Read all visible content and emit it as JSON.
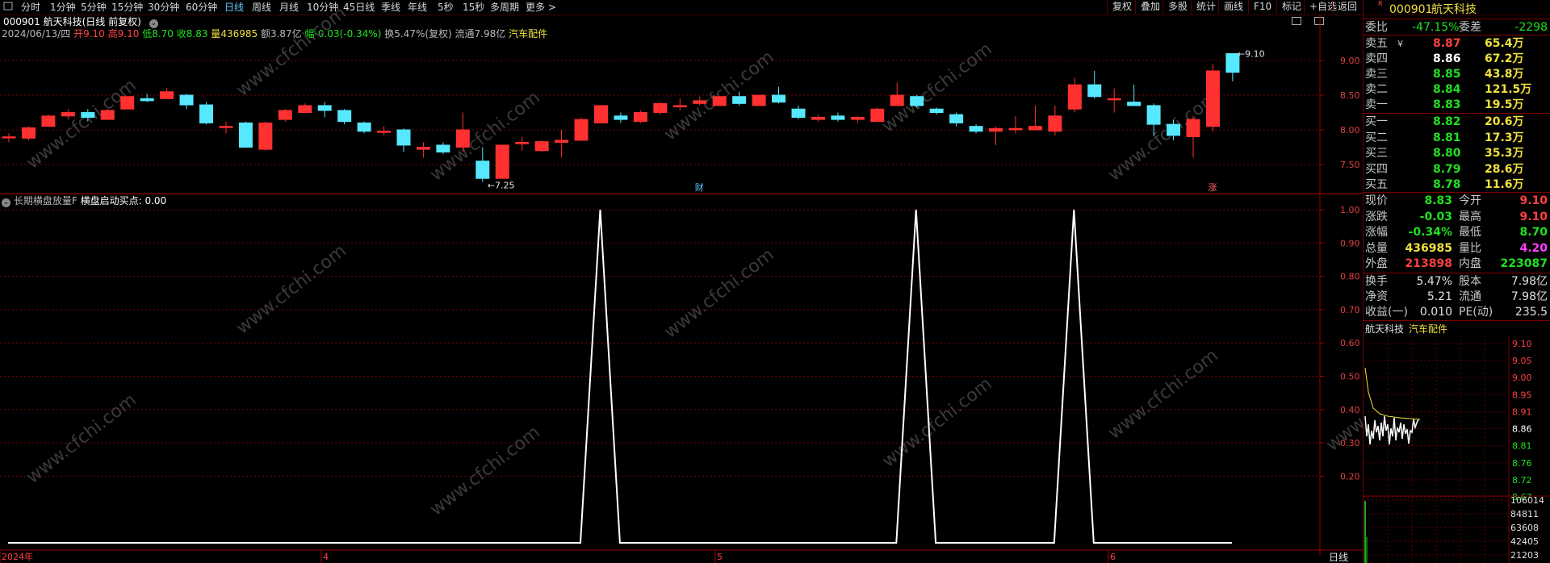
{
  "toolbar": {
    "periods": [
      "分时",
      "1分钟",
      "5分钟",
      "15分钟",
      "30分钟",
      "60分钟",
      "日线",
      "周线",
      "月线",
      "10分钟",
      "45日线",
      "季线",
      "年线",
      "5秒",
      "15秒",
      "多周期",
      "更多 >"
    ],
    "active_period": "日线",
    "right_buttons": [
      "复权",
      "叠加",
      "多股",
      "统计",
      "画线",
      "F10",
      "标记",
      "+自选",
      "返回"
    ]
  },
  "stock": {
    "code": "000901",
    "name": "航天科技",
    "title_line": "000901 航天科技(日线 前复权)",
    "date": "2024/06/13/四",
    "open_label": "开",
    "open": "9.10",
    "high_label": "高",
    "high": "9.10",
    "low_label": "低",
    "low": "8.70",
    "close_label": "收",
    "close": "8.83",
    "vol_label": "量",
    "vol": "436985",
    "amount": "额3.87亿",
    "chg": "幅-0.03(-0.34%)",
    "turnover": "换5.47%(复权)",
    "float_cap": "流通7.98亿",
    "sector": "汽车配件"
  },
  "indicator": {
    "title": "长期横盘放量F",
    "buy_label": "横盘启动买点:",
    "buy_value": "0.00"
  },
  "chart_data": [
    {
      "type": "candlestick",
      "title": "000901 航天科技(日线 前复权)",
      "y_ticks": [
        9.0,
        8.5,
        8.0,
        7.5
      ],
      "ylim": [
        7.2,
        9.4
      ],
      "candles": [
        {
          "o": 7.9,
          "h": 7.95,
          "l": 7.82,
          "c": 7.9
        },
        {
          "o": 7.88,
          "h": 8.05,
          "l": 7.85,
          "c": 8.03
        },
        {
          "o": 8.05,
          "h": 8.22,
          "l": 8.05,
          "c": 8.2
        },
        {
          "o": 8.2,
          "h": 8.3,
          "l": 8.15,
          "c": 8.25
        },
        {
          "o": 8.25,
          "h": 8.3,
          "l": 8.12,
          "c": 8.18
        },
        {
          "o": 8.15,
          "h": 8.3,
          "l": 8.15,
          "c": 8.28
        },
        {
          "o": 8.3,
          "h": 8.48,
          "l": 8.3,
          "c": 8.48
        },
        {
          "o": 8.45,
          "h": 8.52,
          "l": 8.4,
          "c": 8.42
        },
        {
          "o": 8.45,
          "h": 8.6,
          "l": 8.45,
          "c": 8.55
        },
        {
          "o": 8.5,
          "h": 8.52,
          "l": 8.3,
          "c": 8.36
        },
        {
          "o": 8.36,
          "h": 8.4,
          "l": 8.08,
          "c": 8.1
        },
        {
          "o": 8.05,
          "h": 8.12,
          "l": 7.95,
          "c": 8.05
        },
        {
          "o": 8.1,
          "h": 8.12,
          "l": 7.75,
          "c": 7.75
        },
        {
          "o": 7.72,
          "h": 8.12,
          "l": 7.7,
          "c": 8.1
        },
        {
          "o": 8.15,
          "h": 8.3,
          "l": 8.12,
          "c": 8.28
        },
        {
          "o": 8.25,
          "h": 8.38,
          "l": 8.25,
          "c": 8.35
        },
        {
          "o": 8.35,
          "h": 8.4,
          "l": 8.18,
          "c": 8.28
        },
        {
          "o": 8.28,
          "h": 8.3,
          "l": 8.08,
          "c": 8.12
        },
        {
          "o": 8.1,
          "h": 8.12,
          "l": 7.95,
          "c": 7.98
        },
        {
          "o": 7.98,
          "h": 8.05,
          "l": 7.92,
          "c": 7.98
        },
        {
          "o": 8.0,
          "h": 8.02,
          "l": 7.68,
          "c": 7.78
        },
        {
          "o": 7.72,
          "h": 7.82,
          "l": 7.6,
          "c": 7.75
        },
        {
          "o": 7.78,
          "h": 7.82,
          "l": 7.65,
          "c": 7.68
        },
        {
          "o": 7.75,
          "h": 8.25,
          "l": 7.68,
          "c": 8.0
        },
        {
          "o": 7.55,
          "h": 7.75,
          "l": 7.25,
          "c": 7.3
        },
        {
          "o": 7.3,
          "h": 7.78,
          "l": 7.3,
          "c": 7.78
        },
        {
          "o": 7.8,
          "h": 7.9,
          "l": 7.7,
          "c": 7.82
        },
        {
          "o": 7.7,
          "h": 7.85,
          "l": 7.68,
          "c": 7.83
        },
        {
          "o": 7.82,
          "h": 8.0,
          "l": 7.6,
          "c": 7.85
        },
        {
          "o": 7.85,
          "h": 8.18,
          "l": 7.85,
          "c": 8.15
        },
        {
          "o": 8.1,
          "h": 8.35,
          "l": 8.1,
          "c": 8.35
        },
        {
          "o": 8.2,
          "h": 8.25,
          "l": 8.1,
          "c": 8.15
        },
        {
          "o": 8.12,
          "h": 8.28,
          "l": 8.1,
          "c": 8.25
        },
        {
          "o": 8.25,
          "h": 8.4,
          "l": 8.22,
          "c": 8.38
        },
        {
          "o": 8.35,
          "h": 8.45,
          "l": 8.28,
          "c": 8.35
        },
        {
          "o": 8.38,
          "h": 8.48,
          "l": 8.35,
          "c": 8.42
        },
        {
          "o": 8.35,
          "h": 8.48,
          "l": 8.35,
          "c": 8.48
        },
        {
          "o": 8.48,
          "h": 8.55,
          "l": 8.35,
          "c": 8.38
        },
        {
          "o": 8.35,
          "h": 8.5,
          "l": 8.35,
          "c": 8.5
        },
        {
          "o": 8.5,
          "h": 8.62,
          "l": 8.38,
          "c": 8.4
        },
        {
          "o": 8.3,
          "h": 8.35,
          "l": 8.15,
          "c": 8.18
        },
        {
          "o": 8.15,
          "h": 8.22,
          "l": 8.12,
          "c": 8.18
        },
        {
          "o": 8.2,
          "h": 8.25,
          "l": 8.12,
          "c": 8.15
        },
        {
          "o": 8.15,
          "h": 8.2,
          "l": 8.1,
          "c": 8.18
        },
        {
          "o": 8.12,
          "h": 8.32,
          "l": 8.12,
          "c": 8.3
        },
        {
          "o": 8.35,
          "h": 8.68,
          "l": 8.35,
          "c": 8.5
        },
        {
          "o": 8.48,
          "h": 8.5,
          "l": 8.32,
          "c": 8.35
        },
        {
          "o": 8.3,
          "h": 8.32,
          "l": 8.22,
          "c": 8.25
        },
        {
          "o": 8.22,
          "h": 8.25,
          "l": 8.05,
          "c": 8.1
        },
        {
          "o": 8.05,
          "h": 8.08,
          "l": 7.95,
          "c": 7.98
        },
        {
          "o": 7.98,
          "h": 8.05,
          "l": 7.78,
          "c": 8.02
        },
        {
          "o": 8.0,
          "h": 8.2,
          "l": 7.95,
          "c": 8.02
        },
        {
          "o": 8.0,
          "h": 8.35,
          "l": 8.0,
          "c": 8.05
        },
        {
          "o": 7.98,
          "h": 8.35,
          "l": 7.92,
          "c": 8.2
        },
        {
          "o": 8.3,
          "h": 8.75,
          "l": 8.25,
          "c": 8.65
        },
        {
          "o": 8.65,
          "h": 8.85,
          "l": 8.45,
          "c": 8.48
        },
        {
          "o": 8.45,
          "h": 8.6,
          "l": 8.25,
          "c": 8.45
        },
        {
          "o": 8.4,
          "h": 8.65,
          "l": 8.35,
          "c": 8.35
        },
        {
          "o": 8.35,
          "h": 8.38,
          "l": 7.92,
          "c": 8.08
        },
        {
          "o": 8.08,
          "h": 8.15,
          "l": 7.85,
          "c": 7.92
        },
        {
          "o": 7.9,
          "h": 8.2,
          "l": 7.6,
          "c": 8.15
        },
        {
          "o": 8.05,
          "h": 8.95,
          "l": 7.98,
          "c": 8.85
        },
        {
          "o": 9.1,
          "h": 9.1,
          "l": 8.7,
          "c": 8.83
        }
      ],
      "labels": [
        {
          "text": "7.25",
          "price": 7.25,
          "candle": 24
        },
        {
          "text": "9.10",
          "price": 9.1,
          "candle": 62
        }
      ],
      "markers": [
        {
          "text": "财",
          "candle": 35,
          "color": "#5fc8ff"
        },
        {
          "text": "涨",
          "candle": 61,
          "color": "#ff6060"
        }
      ]
    },
    {
      "type": "line",
      "title": "长期横盘放量F",
      "y_ticks": [
        1.0,
        0.9,
        0.8,
        0.7,
        0.6,
        0.5,
        0.4,
        0.3,
        0.2
      ],
      "ylim": [
        0,
        1
      ],
      "series": [
        {
          "name": "横盘启动买点",
          "values": [
            0,
            0,
            0,
            0,
            0,
            0,
            0,
            0,
            0,
            0,
            0,
            0,
            0,
            0,
            0,
            0,
            0,
            0,
            0,
            0,
            0,
            0,
            0,
            0,
            0,
            0,
            0,
            0,
            0,
            0,
            1,
            0,
            0,
            0,
            0,
            0,
            0,
            0,
            0,
            0,
            0,
            0,
            0,
            0,
            0,
            0,
            1,
            0,
            0,
            0,
            0,
            0,
            0,
            0,
            1,
            0,
            0,
            0,
            0,
            0,
            0,
            0,
            0
          ]
        }
      ]
    }
  ],
  "x_axis": {
    "labels": [
      "2024年",
      "4",
      "5",
      "6"
    ],
    "period_label": "日线"
  },
  "watermark": "www.cfchi.com",
  "quote": {
    "header_code": "000901",
    "header_name": "航天科技",
    "weibi_label": "委比",
    "weibi": "-47.15%",
    "weicha_label": "委差",
    "weicha": "-2298",
    "asks": [
      {
        "label": "卖五",
        "price": "8.87",
        "vol": "65.4万",
        "price_color": "#ff4040"
      },
      {
        "label": "卖四",
        "price": "8.86",
        "vol": "67.2万",
        "price_color": "#ffffff"
      },
      {
        "label": "卖三",
        "price": "8.85",
        "vol": "43.8万",
        "price_color": "#20e020"
      },
      {
        "label": "卖二",
        "price": "8.84",
        "vol": "121.5万",
        "price_color": "#20e020"
      },
      {
        "label": "卖一",
        "price": "8.83",
        "vol": "19.5万",
        "price_color": "#20e020"
      }
    ],
    "bids": [
      {
        "label": "买一",
        "price": "8.82",
        "vol": "20.6万"
      },
      {
        "label": "买二",
        "price": "8.81",
        "vol": "17.3万"
      },
      {
        "label": "买三",
        "price": "8.80",
        "vol": "35.3万"
      },
      {
        "label": "买四",
        "price": "8.79",
        "vol": "28.6万"
      },
      {
        "label": "买五",
        "price": "8.78",
        "vol": "11.6万"
      }
    ],
    "stats": [
      {
        "l1": "现价",
        "v1": "8.83",
        "c1": "#20e020",
        "l2": "今开",
        "v2": "9.10",
        "c2": "#ff4040"
      },
      {
        "l1": "涨跌",
        "v1": "-0.03",
        "c1": "#20e020",
        "l2": "最高",
        "v2": "9.10",
        "c2": "#ff4040"
      },
      {
        "l1": "涨幅",
        "v1": "-0.34%",
        "c1": "#20e020",
        "l2": "最低",
        "v2": "8.70",
        "c2": "#20e020"
      },
      {
        "l1": "总量",
        "v1": "436985",
        "c1": "#f0e040",
        "l2": "量比",
        "v2": "4.20",
        "c2": "#ff40ff"
      },
      {
        "l1": "外盘",
        "v1": "213898",
        "c1": "#ff4040",
        "l2": "内盘",
        "v2": "223087",
        "c2": "#20e020"
      }
    ],
    "fundamentals": [
      {
        "l1": "换手",
        "v1": "5.47%",
        "l2": "股本",
        "v2": "7.98亿"
      },
      {
        "l1": "净资",
        "v1": "5.21",
        "l2": "流通",
        "v2": "7.98亿"
      },
      {
        "l1": "收益(一)",
        "v1": "0.010",
        "l2": "PE(动)",
        "v2": "235.5"
      }
    ]
  },
  "mini_chart": {
    "name": "航天科技",
    "sector": "汽车配件",
    "price_ticks": [
      "9.10",
      "9.05",
      "9.00",
      "8.95",
      "8.91",
      "8.86",
      "8.81",
      "8.76",
      "8.72",
      "8.67"
    ],
    "vol_ticks": [
      "106014",
      "84811",
      "63608",
      "42405",
      "21203"
    ]
  },
  "colors": {
    "up": "#ff3030",
    "down": "#55e8ff",
    "grid": "#7a0000",
    "white": "#ffffff"
  }
}
